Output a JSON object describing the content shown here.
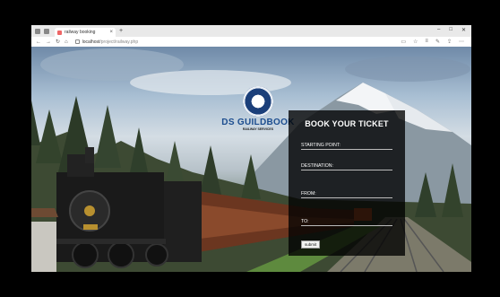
{
  "browser": {
    "tab_title": "railway booking",
    "tab_close": "×",
    "new_tab": "+",
    "url_host": "localhost",
    "url_path": "/project/railway.php",
    "window_controls": [
      "–",
      "□",
      "✕"
    ]
  },
  "logo": {
    "name": "DS GUILDBOOK",
    "tagline": "RAILWAY SERVICES"
  },
  "form": {
    "title": "BOOK YOUR TICKET",
    "starting_point_label": "STARTING POINT:",
    "destination_label": "DESTINATION:",
    "from_label": "FROM:",
    "to_label": "TO:",
    "submit_label": "submit"
  },
  "colors": {
    "panel_bg": "#000000",
    "logo_text": "#1c4d8f"
  }
}
